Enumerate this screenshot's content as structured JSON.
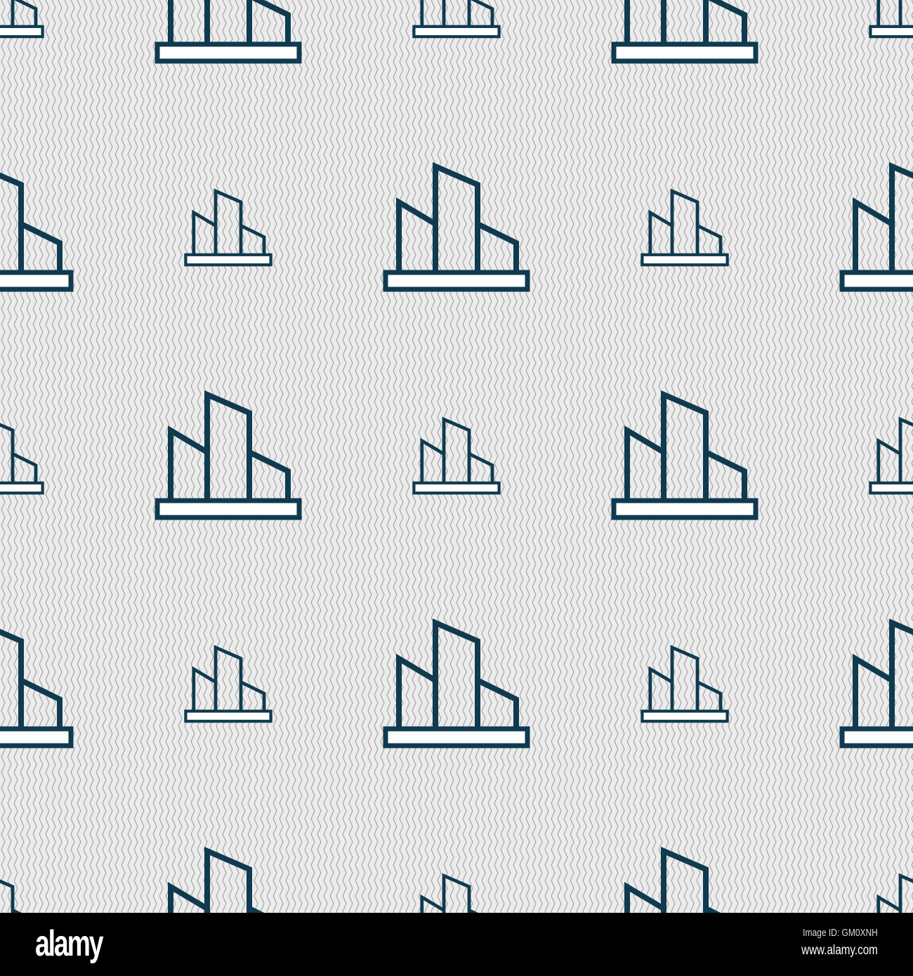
{
  "colors": {
    "background": "#e9e9e9",
    "zigzag": "#a9a9a9",
    "icon": "#0f3a4f",
    "footer": "#000000"
  },
  "icon": "building-chart-icon",
  "footer": {
    "logo": "alamy",
    "image_id": "Image ID: GM0XNH",
    "website": "www.alamy.com"
  }
}
